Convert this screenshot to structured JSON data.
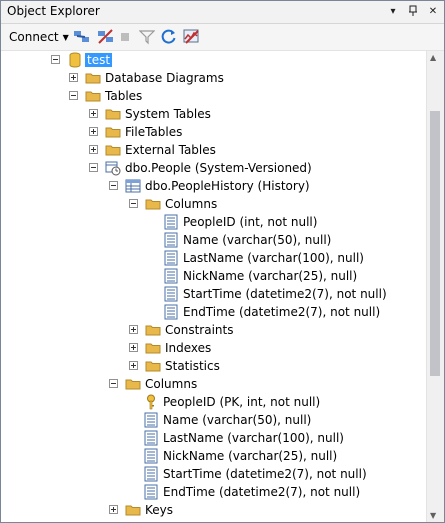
{
  "window": {
    "title": "Object Explorer"
  },
  "toolbar": {
    "connect_label": "Connect"
  },
  "tree": {
    "root": "test",
    "database_diagrams": "Database Diagrams",
    "tables": "Tables",
    "system_tables": "System Tables",
    "filetables": "FileTables",
    "external_tables": "External Tables",
    "people": "dbo.People (System-Versioned)",
    "history": "dbo.PeopleHistory (History)",
    "history_columns_folder": "Columns",
    "history_columns": [
      "PeopleID (int, not null)",
      "Name (varchar(50), null)",
      "LastName (varchar(100), null)",
      "NickName (varchar(25), null)",
      "StartTime (datetime2(7), not null)",
      "EndTime (datetime2(7), not null)"
    ],
    "history_constraints": "Constraints",
    "history_indexes": "Indexes",
    "history_statistics": "Statistics",
    "people_columns_folder": "Columns",
    "people_columns": [
      "PeopleID (PK, int, not null)",
      "Name (varchar(50), null)",
      "LastName (varchar(100), null)",
      "NickName (varchar(25), null)",
      "StartTime (datetime2(7), not null)",
      "EndTime (datetime2(7), not null)"
    ],
    "keys": "Keys"
  }
}
